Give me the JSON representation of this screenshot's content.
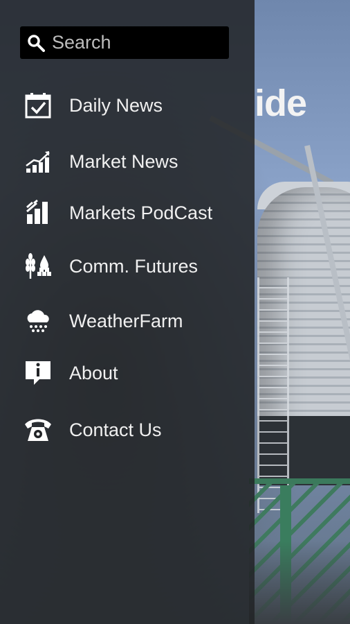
{
  "background": {
    "brand_partial": "ide"
  },
  "drawer": {
    "search": {
      "placeholder": "Search",
      "value": ""
    },
    "items": [
      {
        "label": "Daily News",
        "icon": "calendar-check-icon"
      },
      {
        "label": "Market News",
        "icon": "bar-chart-trend-icon"
      },
      {
        "label": "Markets PodCast",
        "icon": "bars-pattern-icon"
      },
      {
        "label": "Comm. Futures",
        "icon": "wheat-oil-icon"
      },
      {
        "label": "WeatherFarm",
        "icon": "rain-cloud-icon"
      },
      {
        "label": "About",
        "icon": "info-bubble-icon"
      },
      {
        "label": "Contact Us",
        "icon": "telephone-icon"
      }
    ]
  },
  "colors": {
    "drawer_bg": "#222427",
    "text": "#f0f0f0",
    "search_bg": "#000000"
  }
}
